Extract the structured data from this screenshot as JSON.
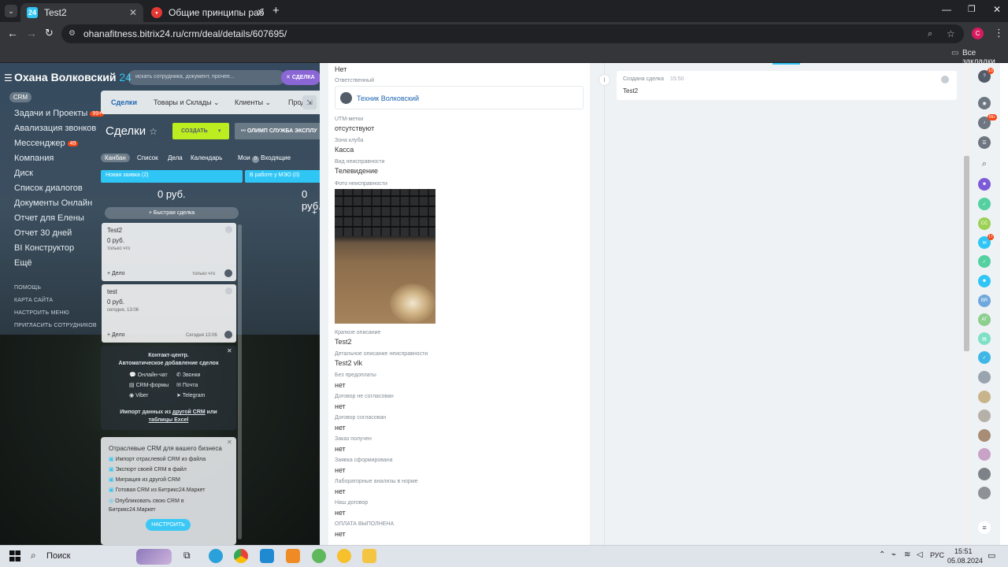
{
  "browser": {
    "tabs": [
      {
        "title": "Test2",
        "active": true
      },
      {
        "title": "Общие принципы работы с по",
        "active": false
      }
    ],
    "url": "ohanafitness.bitrix24.ru/crm/deal/details/607695/",
    "bookmarks_label": "Все закладки",
    "profile_initial": "C"
  },
  "portal": {
    "name": "Охана Волковский",
    "num": "24",
    "search_placeholder": "искать сотрудника, документ, прочее...",
    "deal_button": "СДЕЛКА"
  },
  "sidebar": {
    "crm_label": "CRM",
    "items": [
      {
        "label": "Задачи и Проекты",
        "badge": "99+"
      },
      {
        "label": "Авализация звонков",
        "badge": ""
      },
      {
        "label": "Мессенджер",
        "badge": "49"
      },
      {
        "label": "Компания",
        "badge": ""
      },
      {
        "label": "Диск",
        "badge": ""
      },
      {
        "label": "Список диалогов",
        "badge": ""
      },
      {
        "label": "Документы Онлайн",
        "badge": ""
      },
      {
        "label": "Отчет для Елены",
        "badge": ""
      },
      {
        "label": "Отчет 30 дней",
        "badge": ""
      },
      {
        "label": "BI Конструктор",
        "badge": ""
      },
      {
        "label": "Ещё",
        "badge": ""
      }
    ],
    "small_items": [
      "ПОМОЩЬ",
      "КАРТА САЙТА",
      "НАСТРОИТЬ МЕНЮ",
      "ПРИГЛАСИТЬ СОТРУДНИКОВ"
    ]
  },
  "crm": {
    "nav_tabs": [
      "Сделки",
      "Товары и Склады",
      "Клиенты",
      "Прод"
    ],
    "title": "Сделки",
    "create_button": "СОЗДАТЬ",
    "filter_label": "ОЛИМП СЛУЖБА ЭКСПЛУ",
    "views": [
      "Канбан",
      "Список",
      "Дела",
      "Календарь"
    ],
    "my_label": "Мои",
    "incoming_label": "Входящие",
    "columns": [
      {
        "title": "Новая заявка (2)",
        "sum": "0 руб.",
        "color": "#2fc6f6"
      },
      {
        "title": "В работе у МЭО (0)",
        "sum": "0 руб.",
        "color": "#2fc6f6"
      }
    ],
    "quick_deal": "Быстрая сделка",
    "deals": [
      {
        "title": "Test2",
        "sum": "0 руб.",
        "date": "только что",
        "action": "Дело",
        "time": "только что"
      },
      {
        "title": "test",
        "sum": "0 руб.",
        "date": "сегодня, 13:06",
        "action": "Дело",
        "time": "Сегодня 13:06"
      }
    ],
    "contact_center": {
      "title": "Контакт-центр.",
      "subtitle": "Автоматическое добавление сделок",
      "channels": [
        "Онлайн-чат",
        "Звонки",
        "CRM-формы",
        "Почта",
        "Viber",
        "Telegram"
      ],
      "import_text": "Импорт данных из",
      "import_link": "другой CRM",
      "import_or": "или",
      "import_link2": "таблицы Excel"
    },
    "promo": {
      "title": "Отраслевые CRM для вашего бизнеса",
      "items": [
        "Импорт отраслевой CRM из файла",
        "Экспорт своей CRM в файл",
        "Миграция из другой CRM",
        "Готовая CRM из Битрикс24.Маркет",
        "Опубликовать свою CRM в Битрикс24.Маркет"
      ],
      "button": "НАСТРОИТЬ"
    }
  },
  "deal": {
    "top_value": "Нет",
    "responsible_label": "Ответственный",
    "responsible_name": "Техник Волковский",
    "fields": [
      {
        "label": "UTM-метки",
        "value": "отсутствуют"
      },
      {
        "label": "Зона клуба",
        "value": "Касса"
      },
      {
        "label": "Вид неисправности",
        "value": "Телевидение"
      }
    ],
    "photo_label": "Фото неисправности",
    "fields2": [
      {
        "label": "Краткое описание",
        "value": "Test2"
      },
      {
        "label": "Детальное описание неисправности",
        "value": "Test2 vlk"
      },
      {
        "label": "Без предоплаты",
        "value": "нет"
      },
      {
        "label": "Договор не согласован",
        "value": "нет"
      },
      {
        "label": "Договор согласован",
        "value": "нет"
      },
      {
        "label": "Заказ получен",
        "value": "нет"
      },
      {
        "label": "Заявка сформирована",
        "value": "нет"
      },
      {
        "label": "Лабораторные анализы в норме",
        "value": "нет"
      },
      {
        "label": "Наш договор",
        "value": "нет"
      },
      {
        "label": "ОПЛАТА ВЫПОЛНЕНА",
        "value": "нет"
      }
    ]
  },
  "timeline": {
    "event_title": "Создана сделка",
    "event_time": "15:50",
    "event_text": "Test2"
  },
  "rail": {
    "badges": [
      "10",
      "99+",
      "17"
    ],
    "avatars": [
      "CC",
      "BR",
      "АГ"
    ]
  },
  "taskbar": {
    "search_label": "Поиск",
    "lang": "РУС",
    "time": "15:51",
    "date": "05.08.2024"
  }
}
